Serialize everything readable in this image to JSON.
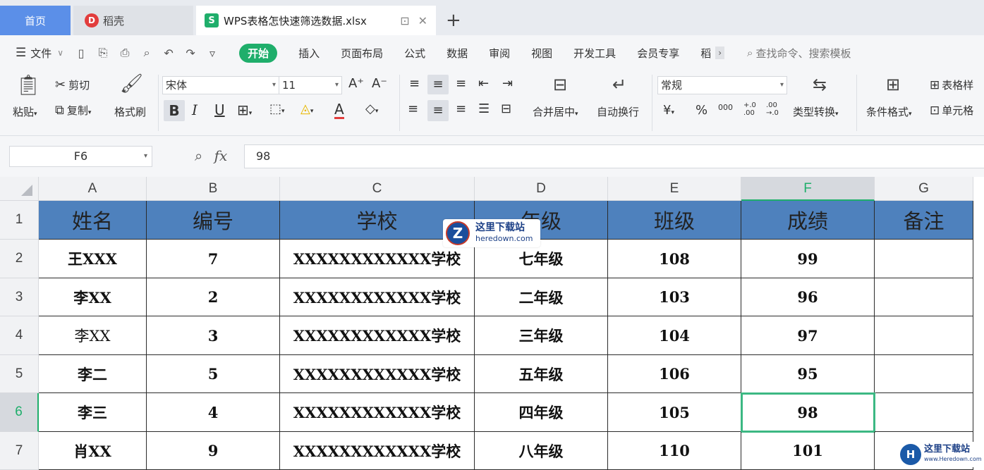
{
  "tabs": {
    "home": "首页",
    "docer": "稻壳",
    "file": "WPS表格怎快速筛选数据.xlsx",
    "add": "+"
  },
  "menu": {
    "file": "文件",
    "items": [
      "开始",
      "插入",
      "页面布局",
      "公式",
      "数据",
      "审阅",
      "视图",
      "开发工具",
      "会员专享",
      "稻"
    ],
    "search": "查找命令、搜索模板"
  },
  "ribbon": {
    "paste": "粘贴",
    "cut": "剪切",
    "copy": "复制",
    "format_painter": "格式刷",
    "font_name": "宋体",
    "font_size": "11",
    "bold": "B",
    "italic": "I",
    "underline": "U",
    "merge_center": "合并居中",
    "wrap_text": "自动换行",
    "number_format": "常规",
    "currency": "¥",
    "percent": "%",
    "thousands": "000",
    "inc_decimal": "+.0 .00",
    "dec_decimal": ".00 →.0",
    "type_convert": "类型转换",
    "cond_format": "条件格式",
    "table_style": "表格样",
    "cell_style": "单元格"
  },
  "formula_bar": {
    "cell_ref": "F6",
    "fx": "fx",
    "value": "98"
  },
  "columns": [
    "A",
    "B",
    "C",
    "D",
    "E",
    "F",
    "G"
  ],
  "selected_column": "F",
  "rows": [
    "1",
    "2",
    "3",
    "4",
    "5",
    "6",
    "7"
  ],
  "selected_row": "6",
  "table": {
    "header": [
      "姓名",
      "编号",
      "学校",
      "年级",
      "班级",
      "成绩",
      "备注"
    ],
    "data": [
      [
        "王XXX",
        "7",
        "XXXXXXXXXXXX学校",
        "七年级",
        "108",
        "99",
        ""
      ],
      [
        "李XX",
        "2",
        "XXXXXXXXXXXX学校",
        "二年级",
        "103",
        "96",
        ""
      ],
      [
        "李XX",
        "3",
        "XXXXXXXXXXXX学校",
        "三年级",
        "104",
        "97",
        ""
      ],
      [
        "李二",
        "5",
        "XXXXXXXXXXXX学校",
        "五年级",
        "106",
        "95",
        ""
      ],
      [
        "李三",
        "4",
        "XXXXXXXXXXXX学校",
        "四年级",
        "105",
        "98",
        ""
      ],
      [
        "肖XX",
        "9",
        "XXXXXXXXXXXX学校",
        "八年级",
        "110",
        "101",
        ""
      ]
    ]
  },
  "watermark": {
    "cn": "这里下载站",
    "en": "heredown.com",
    "en2": "www.Heredown.com"
  },
  "colors": {
    "header_fill": "#4e81bd",
    "accent_green": "#1fae6b",
    "home_tab": "#5b8fe8"
  }
}
